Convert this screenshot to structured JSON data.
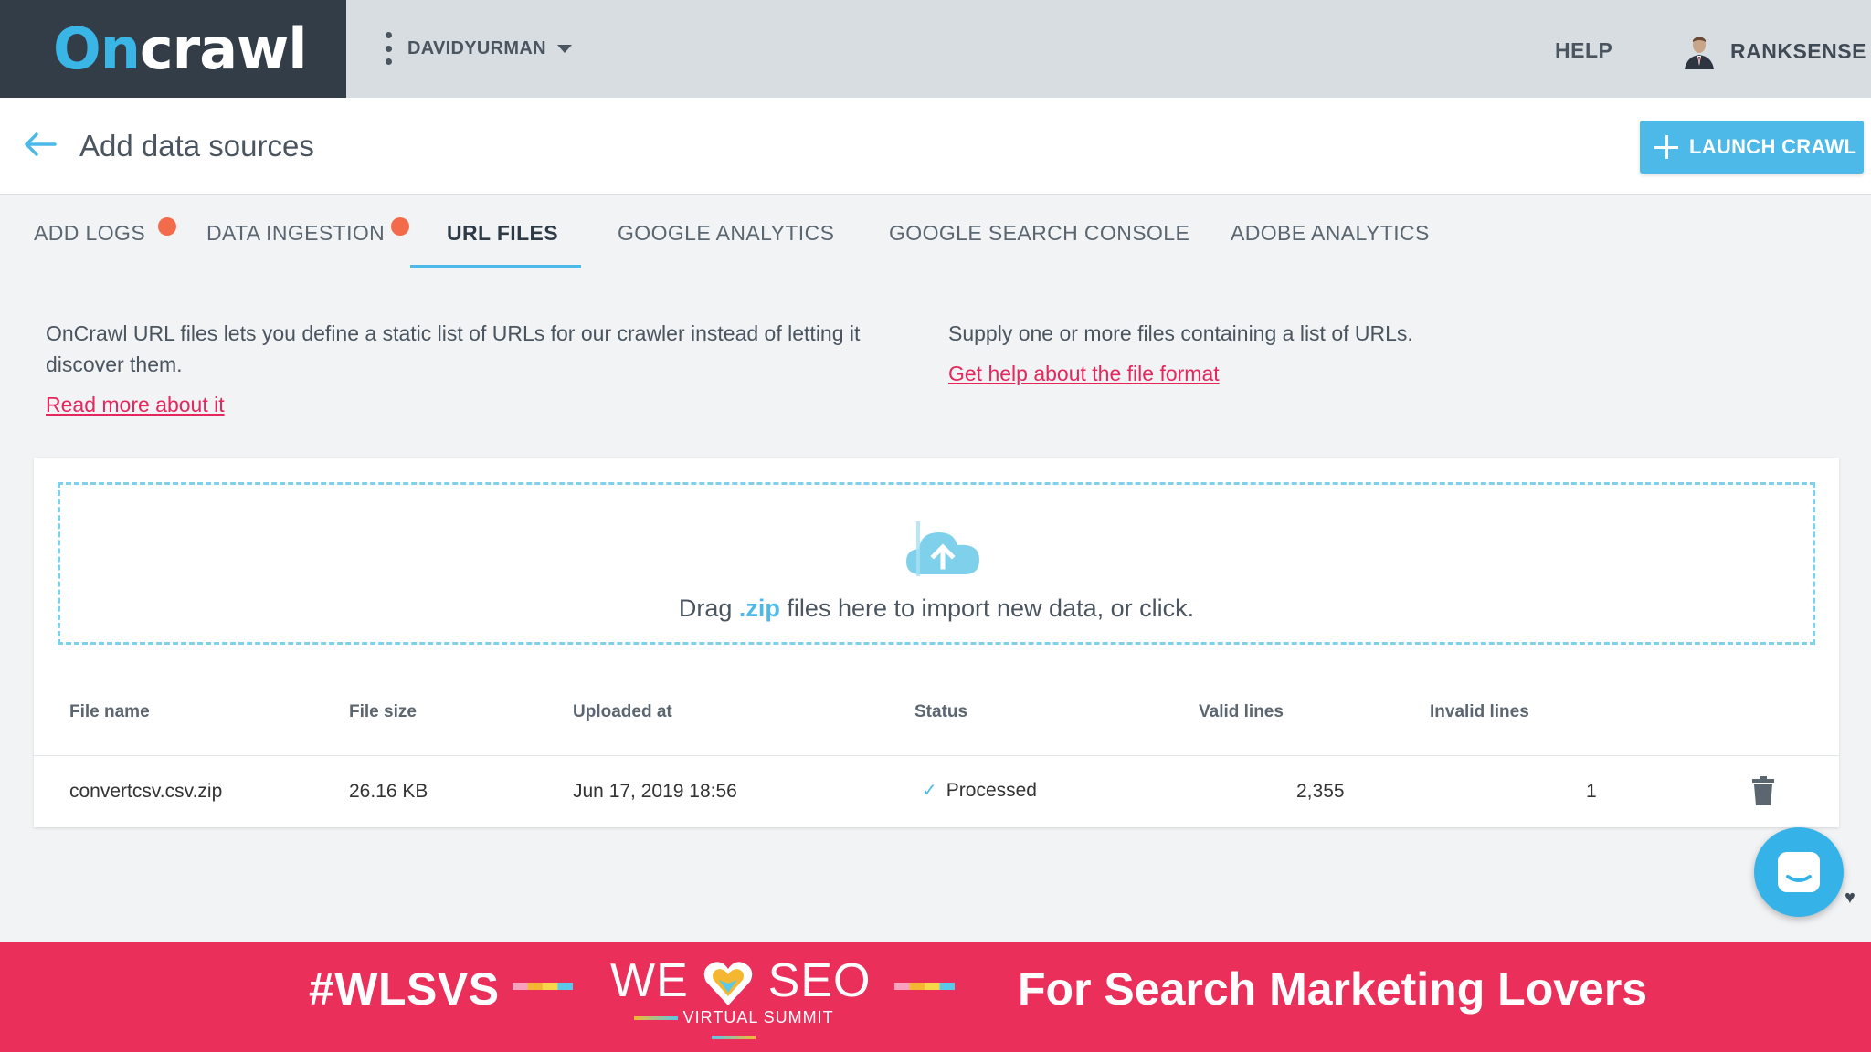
{
  "topbar": {
    "logo_on": "On",
    "logo_rest": "crawl",
    "project_name": "DAVIDYURMAN",
    "help_label": "HELP",
    "user_name": "RANKSENSE"
  },
  "header": {
    "title": "Add data sources",
    "launch_label": "LAUNCH CRAWL"
  },
  "tabs": [
    {
      "label": "ADD LOGS",
      "dot": true
    },
    {
      "label": "DATA INGESTION",
      "dot": true
    },
    {
      "label": "URL FILES",
      "active": true
    },
    {
      "label": "GOOGLE ANALYTICS"
    },
    {
      "label": "GOOGLE SEARCH CONSOLE"
    },
    {
      "label": "ADOBE ANALYTICS"
    }
  ],
  "description": {
    "left_text": "OnCrawl URL files lets you define a static list of URLs for our crawler instead of letting it discover them.",
    "read_more": "Read more about it",
    "right_text": "Supply one or more files containing a list of URLs.",
    "help_link": "Get help about the file format"
  },
  "dropzone": {
    "text_before": "Drag ",
    "ext": ".zip",
    "text_after": " files here to import new data, or click."
  },
  "table": {
    "columns": [
      "File name",
      "File size",
      "Uploaded at",
      "Status",
      "Valid lines",
      "Invalid lines"
    ],
    "rows": [
      {
        "file_name": "convertcsv.csv.zip",
        "file_size": "26.16 KB",
        "uploaded_at": "Jun 17, 2019 18:56",
        "status": "Processed",
        "valid_lines": "2,355",
        "invalid_lines": "1"
      }
    ]
  },
  "banner": {
    "hashtag": "#WLSVS",
    "we": "WE",
    "seo": "SEO",
    "summit": "VIRTUAL SUMMIT",
    "tagline": "For Search Marketing Lovers"
  },
  "colors": {
    "accent": "#4cb9e8",
    "link": "#e4275c",
    "tab_dot": "#f26b4a",
    "banner": "#ea2f5a",
    "logo_bg": "#323d48"
  }
}
